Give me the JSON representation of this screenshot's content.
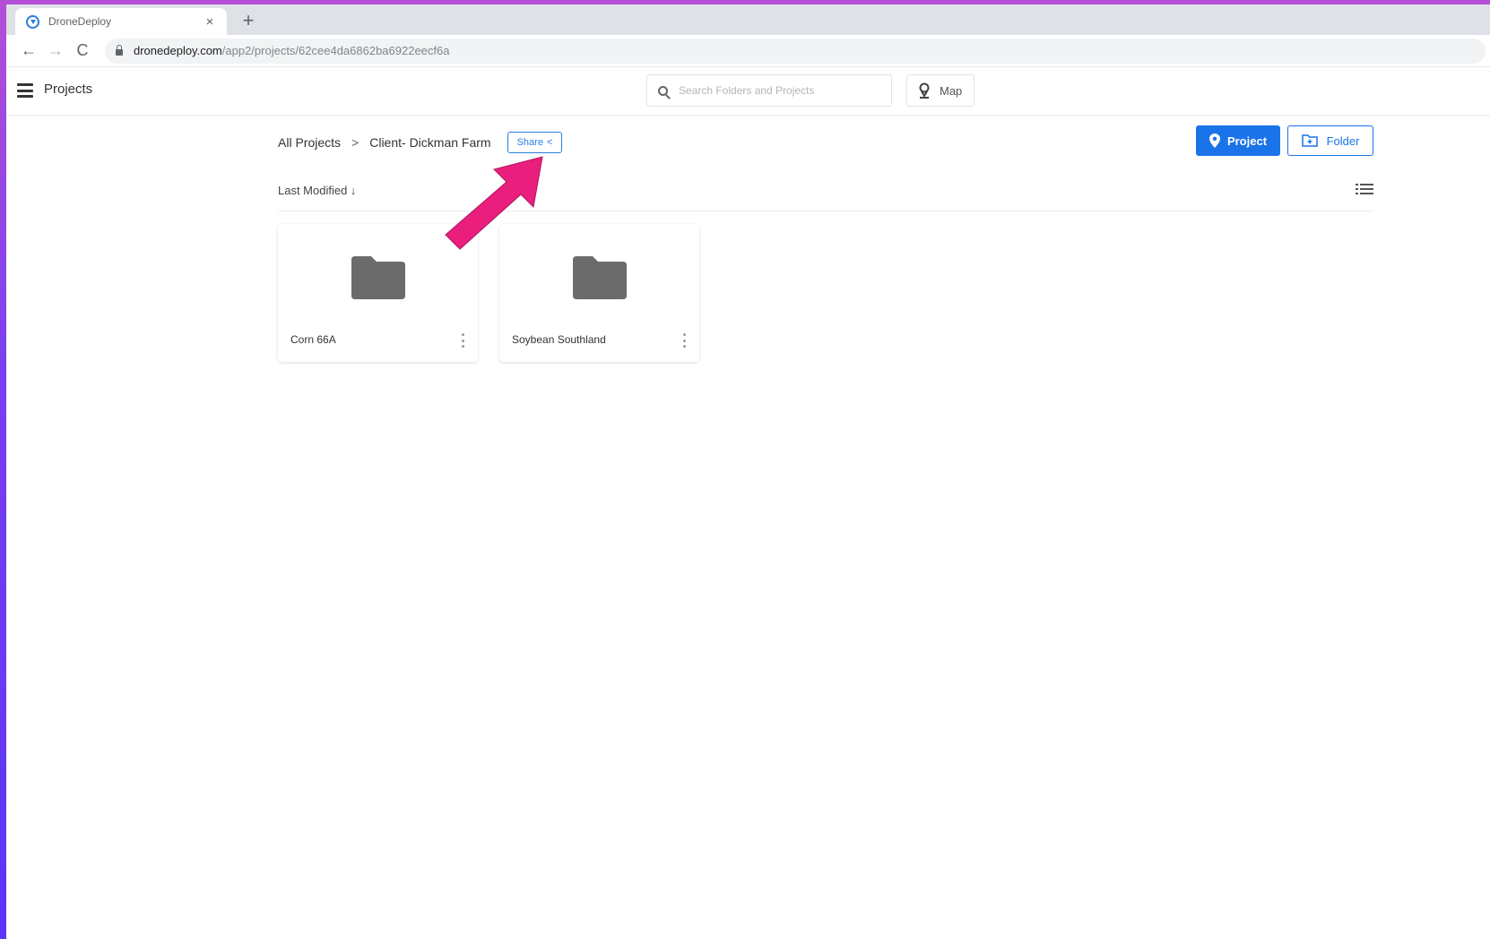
{
  "browser": {
    "tab_title": "DroneDeploy",
    "tab_close": "×",
    "new_tab": "+",
    "url_host": "dronedeploy.com",
    "url_path": "/app2/projects/62cee4da6862ba6922eecf6a",
    "back": "←",
    "forward": "→",
    "reload": "C"
  },
  "header": {
    "title": "Projects",
    "search_placeholder": "Search Folders and Projects",
    "map_label": "Map"
  },
  "breadcrumb": {
    "root": "All Projects",
    "separator": ">",
    "current": "Client- Dickman Farm"
  },
  "share": {
    "label": "Share",
    "glyph": "<"
  },
  "actions": {
    "project_label": "Project",
    "folder_label": "Folder"
  },
  "sort": {
    "label": "Last Modified ↓"
  },
  "folders": [
    {
      "name": "Corn 66A"
    },
    {
      "name": "Soybean Southland"
    }
  ],
  "colors": {
    "accent": "#1a73e8",
    "annotation_arrow": "#e91e7d",
    "folder_icon": "#6b6b6b"
  }
}
